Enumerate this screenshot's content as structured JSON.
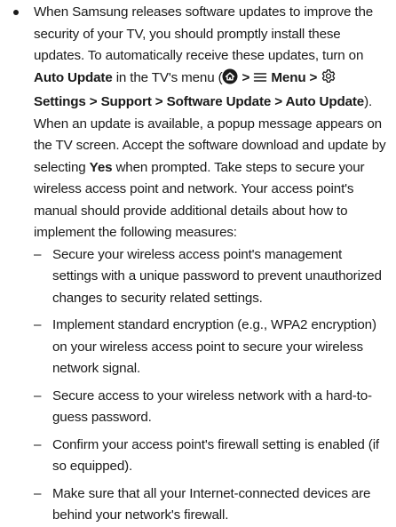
{
  "main": {
    "bullet": {
      "seg1": "When Samsung releases software updates to improve the security of your TV, you should promptly install these updates. To automatically receive these updates, turn on ",
      "auto_update": "Auto Update",
      "seg2": " in the TV's menu (",
      "arrow1": " > ",
      "menu_label": "Menu",
      "arrow2": " > ",
      "path_bold": "Settings > Support > Software Update > Auto Update",
      "seg3": "). When an update is available, a popup message appears on the TV screen. Accept the software download and update by selecting ",
      "yes": "Yes",
      "seg4": " when prompted. Take steps to secure your wireless access point and network. Your access point's manual should provide additional details about how to implement the following measures:"
    },
    "dash": "–",
    "sub_items": [
      "Secure your wireless access point's management settings with a unique password to prevent unauthorized changes to security related settings.",
      "Implement standard encryption (e.g., WPA2 encryption) on your wireless access point to secure your wireless network signal.",
      "Secure access to your wireless network with a hard-to-guess password.",
      "Confirm your access point's firewall setting is enabled (if so equipped).",
      "Make sure that all your Internet-connected devices are behind your network's firewall."
    ]
  },
  "icons": {
    "home": "home-icon",
    "menu": "menu-icon",
    "settings": "gear-icon"
  }
}
